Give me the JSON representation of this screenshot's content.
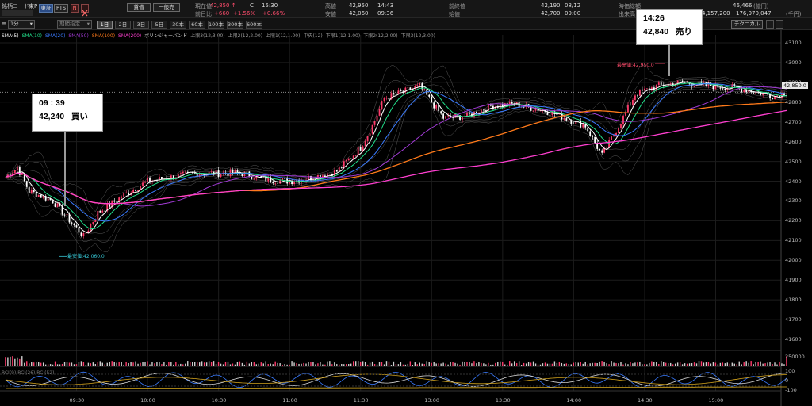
{
  "header": {
    "code_label": "銘柄コード",
    "market": "東P",
    "sor_label": "東証",
    "pts_label": "PTS",
    "n_label": "N",
    "purchase_button": "貸借",
    "margin_button": "一般売"
  },
  "quote": {
    "price_label": "現在値",
    "price": "42,850 ↑",
    "c_flag": "C",
    "time": "15:30",
    "change_label": "前日比",
    "change": "+660",
    "change_pct": "+1.56%",
    "change_pct2": "+0.66%",
    "high_label": "高値",
    "high": "42,950",
    "high_time": "14:43",
    "low_label": "安値",
    "low": "42,060",
    "low_time": "09:36",
    "prev_close_label": "前終値",
    "prev_close": "42,190",
    "prev_close_date": "08/12",
    "open_label": "始値",
    "open": "42,700",
    "open_time": "09:00",
    "mkt_cap_label": "時価総額",
    "mkt_cap": "46,466",
    "mkt_cap_unit": "(億円)",
    "volume_label": "出来高",
    "volume": "4,157,200",
    "turnover": "176,970,047",
    "turnover_unit": "(千円)"
  },
  "toolbar": {
    "chart_toggle": "≡",
    "period_select": "1分",
    "range_select": "期間指定",
    "timeframes": [
      "1日",
      "2日",
      "3日",
      "5日",
      "30本",
      "60本",
      "100本",
      "300本",
      "600本"
    ],
    "active_timeframe": 0,
    "technical_button": "テクニカル"
  },
  "legend": {
    "items": [
      {
        "label": "SMA(5)",
        "color": "#ffffff"
      },
      {
        "label": "SMA(10)",
        "color": "#22e08c"
      },
      {
        "label": "SMA(20)",
        "color": "#3a7bff"
      },
      {
        "label": "SMA(50)",
        "color": "#a23bd6"
      },
      {
        "label": "SMA(100)",
        "color": "#ff7a1a"
      },
      {
        "label": "SMA(200)",
        "color": "#ff3fd0"
      },
      {
        "label": "ボリンジャーバンド",
        "color": "#dddddd"
      },
      {
        "label": "上限3(12,3.00)",
        "color": "#9a9a9a"
      },
      {
        "label": "上限2(12,2.00)",
        "color": "#9a9a9a"
      },
      {
        "label": "上限1(12,1.00)",
        "color": "#9a9a9a"
      },
      {
        "label": "中央(12)",
        "color": "#9a9a9a"
      },
      {
        "label": "下限1(12,1.00)",
        "color": "#9a9a9a"
      },
      {
        "label": "下限2(12,2.00)",
        "color": "#9a9a9a"
      },
      {
        "label": "下限3(12,3.00)",
        "color": "#9a9a9a"
      }
    ]
  },
  "annotations": {
    "buy": {
      "time": "09 : 39",
      "price": "42,240",
      "action": "買い"
    },
    "sell": {
      "time": "14:26",
      "price": "42,840",
      "action": "売り"
    }
  },
  "markers": {
    "low_marker": "最安値:42,060.0",
    "high_marker": "最高値:42,950.0",
    "current_price_tag": "42,850.0"
  },
  "sub_panels": {
    "volume_max_label": "250000",
    "osc_legend": "RCI(9) RCI(26) RCI(52)",
    "osc_top": "100",
    "osc_mid": "0",
    "osc_bottom": "-100"
  },
  "chart_data": {
    "type": "candlestick",
    "title": "",
    "y_ticks": [
      43100,
      43000,
      42900,
      42800,
      42700,
      42600,
      42500,
      42400,
      42300,
      42200,
      42100,
      42000,
      41900,
      41800,
      41700,
      41600
    ],
    "ylim": [
      41560,
      43140
    ],
    "x_ticks": [
      "09:30",
      "10:00",
      "10:30",
      "11:00",
      "11:30",
      "13:00",
      "13:30",
      "14:00",
      "14:30",
      "15:00"
    ],
    "series_close_keypoints": [
      {
        "t": "09:00",
        "v": 42420
      },
      {
        "t": "09:05",
        "v": 42470
      },
      {
        "t": "09:10",
        "v": 42350
      },
      {
        "t": "09:20",
        "v": 42300
      },
      {
        "t": "09:33",
        "v": 42120
      },
      {
        "t": "09:39",
        "v": 42240
      },
      {
        "t": "09:50",
        "v": 42330
      },
      {
        "t": "10:00",
        "v": 42400
      },
      {
        "t": "10:20",
        "v": 42440
      },
      {
        "t": "10:40",
        "v": 42440
      },
      {
        "t": "10:50",
        "v": 42410
      },
      {
        "t": "11:00",
        "v": 42400
      },
      {
        "t": "11:10",
        "v": 42420
      },
      {
        "t": "11:20",
        "v": 42450
      },
      {
        "t": "11:30",
        "v": 42570
      },
      {
        "t": "11:35",
        "v": 42680
      },
      {
        "t": "12:40",
        "v": 42820
      },
      {
        "t": "12:55",
        "v": 42880
      },
      {
        "t": "13:05",
        "v": 42720
      },
      {
        "t": "13:15",
        "v": 42730
      },
      {
        "t": "13:25",
        "v": 42780
      },
      {
        "t": "13:35",
        "v": 42790
      },
      {
        "t": "13:50",
        "v": 42750
      },
      {
        "t": "14:05",
        "v": 42680
      },
      {
        "t": "14:12",
        "v": 42530
      },
      {
        "t": "14:20",
        "v": 42700
      },
      {
        "t": "14:26",
        "v": 42840
      },
      {
        "t": "14:35",
        "v": 42880
      },
      {
        "t": "14:45",
        "v": 42900
      },
      {
        "t": "15:00",
        "v": 42880
      },
      {
        "t": "15:10",
        "v": 42870
      },
      {
        "t": "15:25",
        "v": 42830
      },
      {
        "t": "15:30",
        "v": 42850
      }
    ],
    "sma": [
      {
        "name": "SMA(5)",
        "color": "#ffffff"
      },
      {
        "name": "SMA(10)",
        "color": "#22e08c"
      },
      {
        "name": "SMA(20)",
        "color": "#3a7bff"
      },
      {
        "name": "SMA(50)",
        "color": "#a23bd6"
      },
      {
        "name": "SMA(100)",
        "color": "#ff7a1a"
      },
      {
        "name": "SMA(200)",
        "color": "#ff3fd0"
      }
    ],
    "bollinger": {
      "period": 12,
      "sigmas": [
        1,
        2,
        3
      ]
    },
    "high": 42950,
    "low": 42060,
    "last": 42850
  }
}
